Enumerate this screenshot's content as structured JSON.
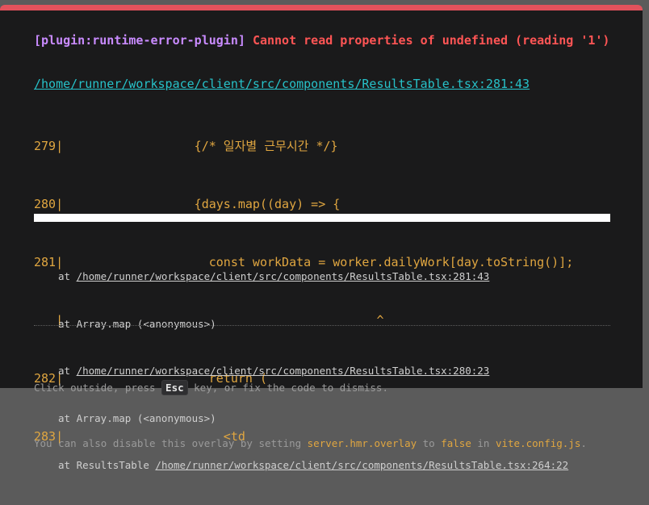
{
  "error": {
    "plugin": "[plugin:runtime-error-plugin]",
    "message": "Cannot read properties of undefined (reading '1')"
  },
  "file_link": "/home/runner/workspace/client/src/components/ResultsTable.tsx:281:43",
  "frame_lines": [
    "279|                  {/* 일자별 근무시간 */}",
    "280|                  {days.map((day) => {",
    "281|                    const workData = worker.dailyWork[day.toString()];",
    "   |                                           ^",
    "282|                    return (",
    "283|                      <td"
  ],
  "stack": [
    {
      "prefix": "at ",
      "link": "/home/runner/workspace/client/src/components/ResultsTable.tsx:281:43"
    },
    {
      "prefix": "at Array.map (<anonymous>)",
      "link": ""
    },
    {
      "prefix": "at ",
      "link": "/home/runner/workspace/client/src/components/ResultsTable.tsx:280:23"
    },
    {
      "prefix": "at Array.map (<anonymous>)",
      "link": ""
    },
    {
      "prefix": "at ResultsTable ",
      "link": "/home/runner/workspace/client/src/components/ResultsTable.tsx:264:22"
    }
  ],
  "tip": {
    "line1_a": "Click outside, press ",
    "key": "Esc",
    "line1_b": " key, or fix the code to dismiss.",
    "line2_a": "You can also disable this overlay by setting ",
    "setting": "server.hmr.overlay",
    "line2_b": " to ",
    "value": "false",
    "line2_c": " in ",
    "config": "vite.config.js",
    "line2_d": "."
  },
  "colors": {
    "accent_bar": "#e2525c",
    "error_text": "#ff5555",
    "plugin_text": "#c98bff",
    "file_link": "#27c2c9",
    "code_frame": "#e0a640"
  }
}
